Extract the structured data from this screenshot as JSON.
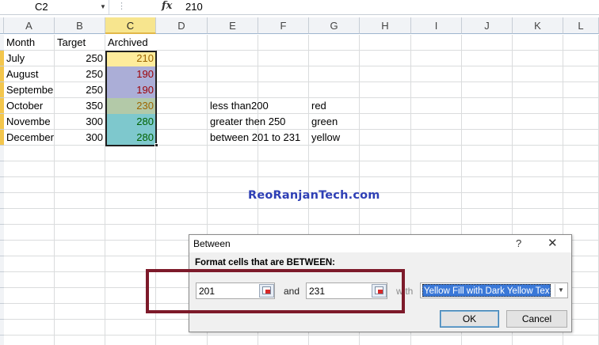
{
  "formula_bar": {
    "name_box": "C2",
    "fx_label": "fx",
    "value": "210"
  },
  "columns": [
    "A",
    "B",
    "C",
    "D",
    "E",
    "F",
    "G",
    "H",
    "I",
    "J",
    "K",
    "L"
  ],
  "cells": {
    "A1": "Month",
    "B1": "Target",
    "C1": "Archived",
    "A2": "July",
    "B2": "250",
    "C2": "210",
    "A3": "August",
    "B3": "250",
    "C3": "190",
    "A4": "Septembe",
    "B4": "250",
    "C4": "190",
    "A5": "October",
    "B5": "350",
    "C5": "230",
    "A6": "Novembe",
    "B6": "300",
    "C6": "280",
    "A7": "December",
    "B7": "300",
    "C7": "280",
    "E5": "less than200",
    "G5": "red",
    "E6": "greater then 250",
    "G6": "green",
    "E7": "between 201 to 231",
    "G7": "yellow"
  },
  "cell_colors": {
    "C2": {
      "fill": "#feec9c",
      "text": "#9c6500"
    },
    "C3": {
      "fill": "#abaed7",
      "text": "#9c0006"
    },
    "C4": {
      "fill": "#abaed7",
      "text": "#9c0006"
    },
    "C5": {
      "fill": "#b3c9a8",
      "text": "#9c6500"
    },
    "C6": {
      "fill": "#7ec8cd",
      "text": "#006100"
    },
    "C7": {
      "fill": "#7ec8cd",
      "text": "#006100"
    }
  },
  "watermark": "ReoRanjanTech.com",
  "dialog": {
    "title": "Between",
    "help": "?",
    "close": "✕",
    "label": "Format cells that are BETWEEN:",
    "value1": "201",
    "and_label": "and",
    "value2": "231",
    "with_label": "with",
    "format_selected": "Yellow Fill with Dark Yellow Text",
    "ok_label": "OK",
    "cancel_label": "Cancel"
  },
  "colors": {
    "highlight_box": "#7d1a2a",
    "selected_header": "#f7e58e",
    "watermark": "#2e3fb5"
  }
}
